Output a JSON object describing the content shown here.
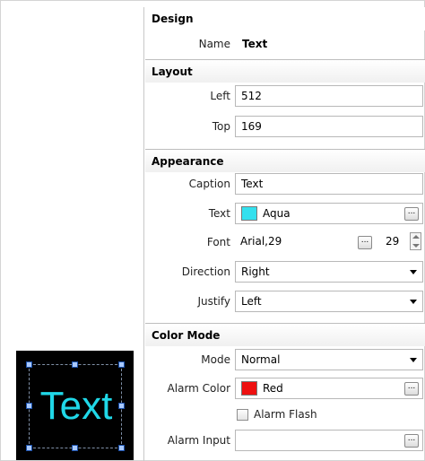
{
  "sections": {
    "design": "Design",
    "layout": "Layout",
    "appearance": "Appearance",
    "color_mode": "Color Mode"
  },
  "design": {
    "name_label": "Name",
    "name_value": "Text"
  },
  "layout": {
    "left_label": "Left",
    "left_value": "512",
    "top_label": "Top",
    "top_value": "169"
  },
  "appearance": {
    "caption_label": "Caption",
    "caption_value": "Text",
    "text_label": "Text",
    "text_color_name": "Aqua",
    "text_color_hex": "#33e0ee",
    "font_label": "Font",
    "font_value": "Arial,29",
    "font_size": "29",
    "direction_label": "Direction",
    "direction_value": "Right",
    "justify_label": "Justify",
    "justify_value": "Left"
  },
  "color_mode": {
    "mode_label": "Mode",
    "mode_value": "Normal",
    "alarm_color_label": "Alarm Color",
    "alarm_color_name": "Red",
    "alarm_color_hex": "#ee1111",
    "alarm_flash_label": "Alarm Flash",
    "alarm_input_label": "Alarm Input",
    "alarm_input_value": ""
  },
  "buttons": {
    "ellipsis": "..."
  },
  "preview": {
    "text": "Text"
  }
}
